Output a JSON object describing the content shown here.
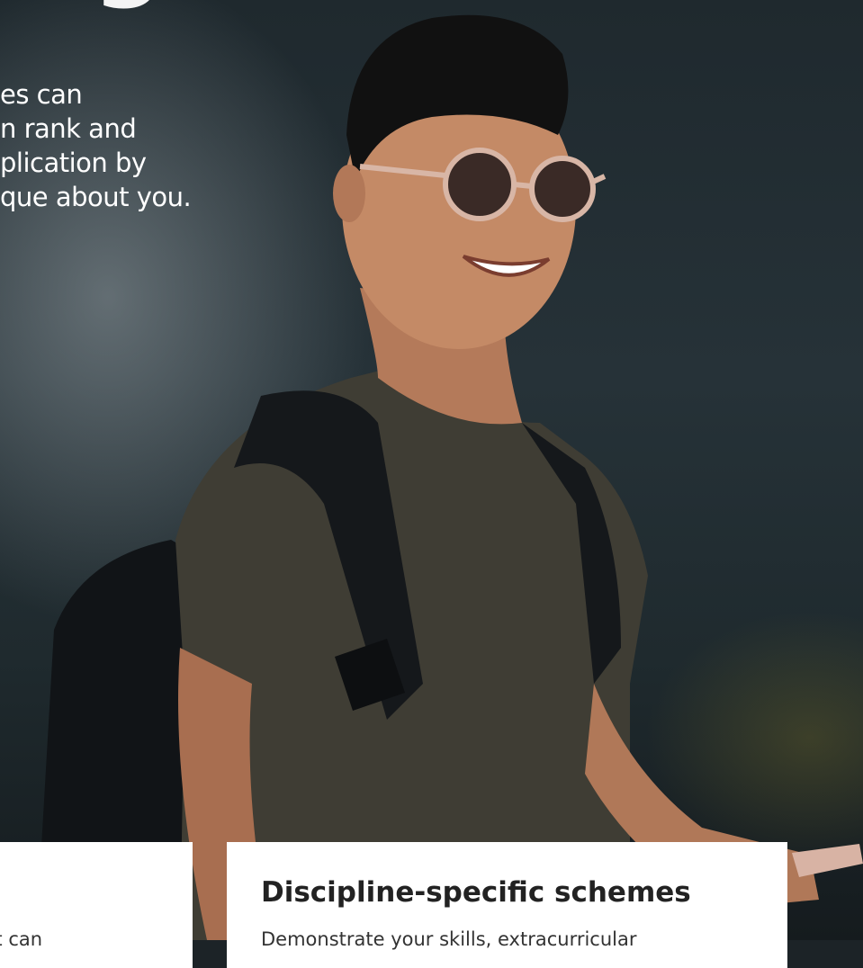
{
  "hero": {
    "heading": "ng in",
    "intro_lines": [
      "es can",
      "n rank and",
      "plication by",
      "que about you."
    ],
    "photo_subject": "smiling young man wearing sunglasses and a dark backpack",
    "colors": {
      "text": "#ffffff",
      "background": "#263238"
    }
  },
  "cards": [
    {
      "title": "",
      "text": "that can"
    },
    {
      "title": "Discipline-specific schemes",
      "text": "Demonstrate your skills, extracurricular"
    }
  ]
}
